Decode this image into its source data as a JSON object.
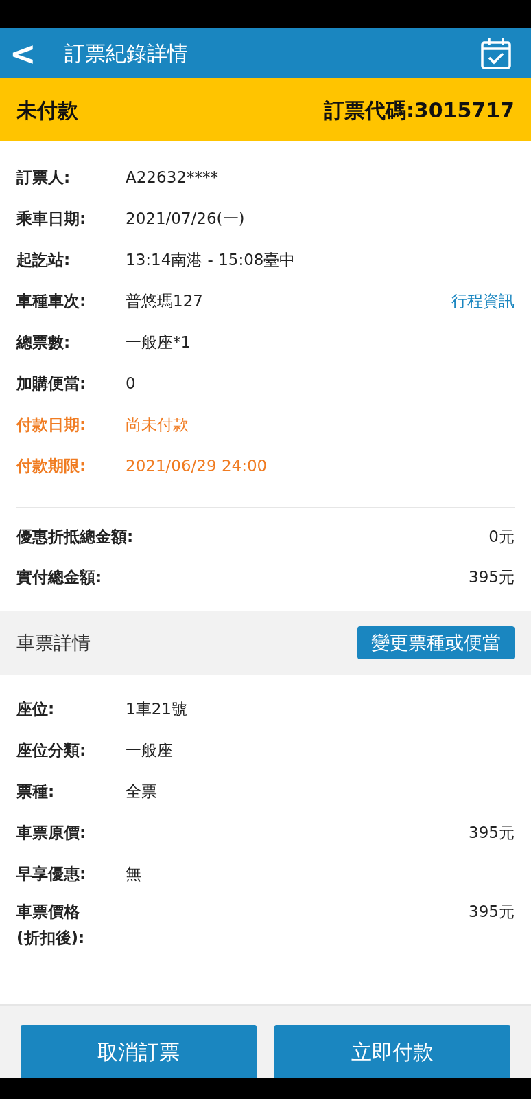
{
  "header": {
    "back_icon": "<",
    "title": "訂票紀錄詳情"
  },
  "status_banner": {
    "status": "未付款",
    "code": "訂票代碼:3015717"
  },
  "booking_rows": [
    {
      "label": "訂票人:",
      "value": "A22632****",
      "highlight": false
    },
    {
      "label": "乘車日期:",
      "value": "2021/07/26(一)",
      "highlight": false
    },
    {
      "label": "起訖站:",
      "value": "13:14南港 - 15:08臺中",
      "highlight": false
    },
    {
      "label": "車種車次:",
      "value": "普悠瑪127",
      "highlight": false,
      "link": "行程資訊"
    },
    {
      "label": "總票數:",
      "value": "一般座*1",
      "highlight": false
    },
    {
      "label": "加購便當:",
      "value": "0",
      "highlight": false
    },
    {
      "label": "付款日期:",
      "value": "尚未付款",
      "highlight": true
    },
    {
      "label": "付款期限:",
      "value": "2021/06/29 24:00",
      "highlight": true
    }
  ],
  "totals": [
    {
      "label": "優惠折抵總金額:",
      "value": "0元"
    },
    {
      "label": "實付總金額:",
      "value": "395元"
    }
  ],
  "ticket_section": {
    "title": "車票詳情",
    "button": "變更票種或便當"
  },
  "ticket_rows": [
    {
      "kind": "left",
      "label": "座位:",
      "value": "1車21號"
    },
    {
      "kind": "left",
      "label": "座位分類:",
      "value": "一般座"
    },
    {
      "kind": "left",
      "label": "票種:",
      "value": "全票"
    },
    {
      "kind": "right",
      "label": "車票原價:",
      "value": "395元"
    },
    {
      "kind": "left",
      "label": "早享優惠:",
      "value": "無"
    },
    {
      "kind": "right",
      "label": "車票價格\n(折扣後):",
      "value": "395元"
    }
  ],
  "actions": [
    "取消訂票",
    "立即付款"
  ]
}
